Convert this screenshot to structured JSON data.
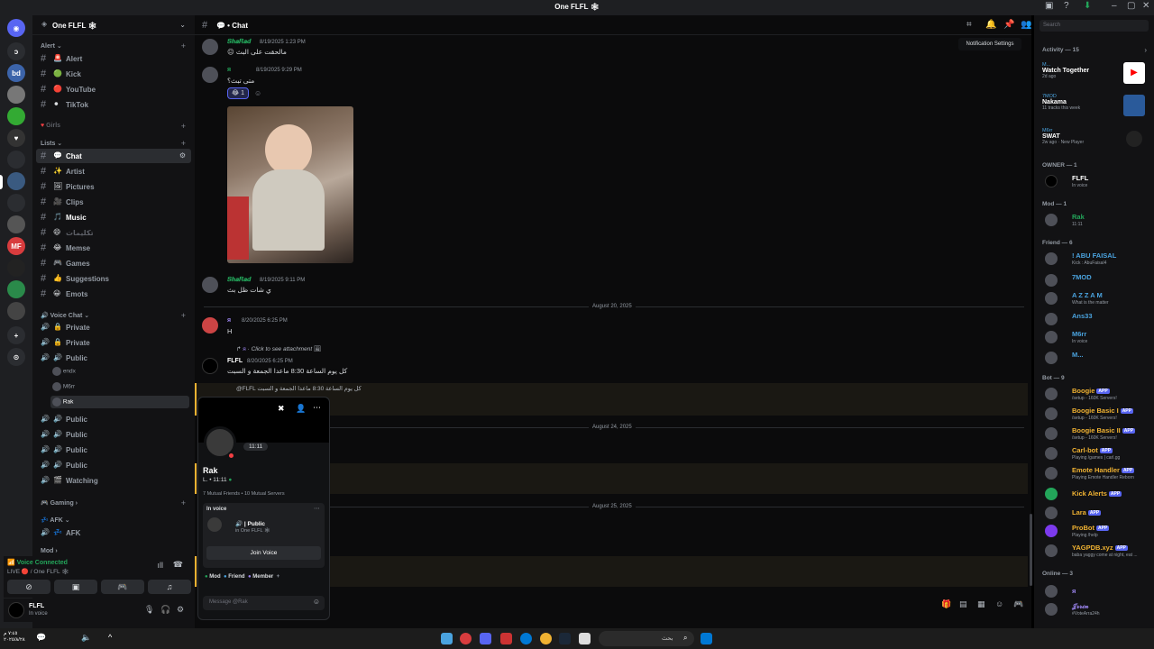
{
  "window": {
    "title": "One FLFL 🕸"
  },
  "guild": {
    "name": "One FLFL 🕸"
  },
  "sidebar": {
    "categories": {
      "alert": "Alert",
      "girls": "Girls",
      "lists": "Lists",
      "voice": "Voice Chat",
      "gaming": "Gaming",
      "afk": "AFK",
      "mod": "Mod"
    },
    "channels": [
      {
        "emoji": "🚨",
        "label": "Alert"
      },
      {
        "emoji": "🟢",
        "label": "Kick"
      },
      {
        "emoji": "🔴",
        "label": "YouTube"
      },
      {
        "emoji": "⚫",
        "label": "TikTok"
      },
      {
        "emoji": "💬",
        "label": "Chat"
      },
      {
        "emoji": "✨",
        "label": "Artist"
      },
      {
        "emoji": "🖼",
        "label": "Pictures"
      },
      {
        "emoji": "🎥",
        "label": "Clips"
      },
      {
        "emoji": "🎵",
        "label": "Music"
      },
      {
        "emoji": "😄",
        "label": "تكليمات"
      },
      {
        "emoji": "😂",
        "label": "Memse"
      },
      {
        "emoji": "🎮",
        "label": "Games"
      },
      {
        "emoji": "👍",
        "label": "Suggestions"
      },
      {
        "emoji": "😀",
        "label": "Emots"
      }
    ],
    "voice_channels": [
      {
        "label": "Private"
      },
      {
        "label": "Private"
      },
      {
        "label": "Public"
      },
      {
        "label": "Public"
      },
      {
        "label": "Public"
      },
      {
        "label": "Public"
      },
      {
        "label": "Public"
      },
      {
        "label": "Watching"
      }
    ],
    "voice_users": [
      "endx",
      "M6rr",
      "Rak"
    ],
    "afk_channel": "AFK"
  },
  "voice_status": {
    "connected": "Voice Connected",
    "server": "LIVE 🔴 / One FLFL 🕸"
  },
  "user": {
    "name": "FLFL",
    "status": "In voice"
  },
  "chat": {
    "header_title": "Chat",
    "tooltip": "Notification Settings",
    "messages": [
      {
        "user": "𝑺𝒉𝒂𝑹𝒂𝒅",
        "time": "8/19/2025 1:23 PM",
        "text": "مالحقت على البث"
      },
      {
        "user": "ᴙ",
        "time": "8/19/2025 9:29 PM",
        "text": "متى تبث؟"
      },
      {
        "user": "𝑺𝒉𝒂𝑹𝒂𝒅",
        "time": "8/19/2025 9:11 PM",
        "text": "ي شات ظل بث"
      },
      {
        "user": "ᴙ",
        "time": "8/20/2025 6:25 PM",
        "text": "H"
      },
      {
        "user": "FLFL",
        "time": "8/20/2025 6:25 PM",
        "text": "كل يوم الساعة 8:30 ماعدا الجمعة و السبت"
      }
    ],
    "reply_preview": "Click to see attachment",
    "mention_line": "@FLFL كل يوم الساعة 8:30 ماعدا الجمعة و السبت",
    "dates": [
      "August 20, 2025",
      "August 24, 2025",
      "August 25, 2025"
    ],
    "reaction_count": "1"
  },
  "popup": {
    "name": "Rak",
    "tag": "11:11",
    "subline": "L. • 11:11",
    "mutuals": "7 Mutual Friends • 10 Mutual Servers",
    "in_voice_label": "In voice",
    "voice_channel": "🔊 | Public",
    "voice_server": "in One FLFL 🕸",
    "join": "Join Voice",
    "roles": [
      "Mod",
      "Friend",
      "Member"
    ],
    "placeholder": "Message @Rak"
  },
  "members": {
    "search_placeholder": "Search",
    "activity_header": "Activity — 15",
    "activities": [
      {
        "user": "M...",
        "title": "Watch Together",
        "sub": "2d ago"
      },
      {
        "user": "7MOD",
        "title": "Nakama",
        "sub": "11 tracks this week"
      },
      {
        "user": "M6rr",
        "title": "SWAT",
        "sub": "2w ago · New Player"
      }
    ],
    "groups": [
      {
        "header": "OWNER — 1",
        "people": [
          {
            "name": "FLFL",
            "status": "In voice",
            "color": "#ffffff"
          }
        ]
      },
      {
        "header": "Mod — 1",
        "people": [
          {
            "name": "Rak",
            "status": "11:11",
            "color": "#43b581"
          }
        ]
      },
      {
        "header": "Friend — 6",
        "people": [
          {
            "name": "! ABU FAISAL",
            "status": "Kick : AbuFaisal4",
            "color": "#4aa3df"
          },
          {
            "name": "7MOD",
            "status": "",
            "color": "#4aa3df"
          },
          {
            "name": "A Z Z A M",
            "status": "What is the matter",
            "color": "#4aa3df"
          },
          {
            "name": "Ans33",
            "status": "",
            "color": "#4aa3df"
          },
          {
            "name": "M6rr",
            "status": "In voice",
            "color": "#4aa3df"
          },
          {
            "name": "M...",
            "status": "",
            "color": "#4aa3df"
          }
        ]
      },
      {
        "header": "Bot — 9",
        "people": [
          {
            "name": "Boogie",
            "status": "/setup - 160K Servers!",
            "color": "#f0b232",
            "app": "APP"
          },
          {
            "name": "Boogie Basic I",
            "status": "/setup - 160K Servers!",
            "color": "#f0b232",
            "app": "APP"
          },
          {
            "name": "Boogie Basic II",
            "status": "/setup - 160K Servers!",
            "color": "#f0b232",
            "app": "APP"
          },
          {
            "name": "Carl-bot",
            "status": "Playing /games | carl.gg",
            "color": "#f0b232",
            "app": "APP"
          },
          {
            "name": "Emote Handler",
            "status": "Playing Emote Handler Reborn",
            "color": "#f0b232",
            "app": "APP"
          },
          {
            "name": "Kick Alerts",
            "status": "",
            "color": "#f0b232",
            "app": "APP"
          },
          {
            "name": "Lara",
            "status": "",
            "color": "#f0b232",
            "app": "APP"
          },
          {
            "name": "ProBot",
            "status": "Playing /help",
            "color": "#f0b232",
            "app": "APP"
          },
          {
            "name": "YAGPDB.xyz",
            "status": "baba yaggy come at night, eat ...",
            "color": "#f0b232",
            "app": "APP"
          }
        ]
      },
      {
        "header": "Online — 3",
        "people": [
          {
            "name": "ᴙ",
            "status": "",
            "color": "#9b84ee"
          },
          {
            "name": "𝒥𝓇𝓇𝒾𝓃",
            "status": "#VoteArra24h",
            "color": "#9b84ee"
          }
        ]
      }
    ]
  },
  "taskbar": {
    "clock_time": "٧:٤٥ م",
    "clock_date": "٢٠٢٥/٨/٢٨",
    "search": "بحث"
  }
}
